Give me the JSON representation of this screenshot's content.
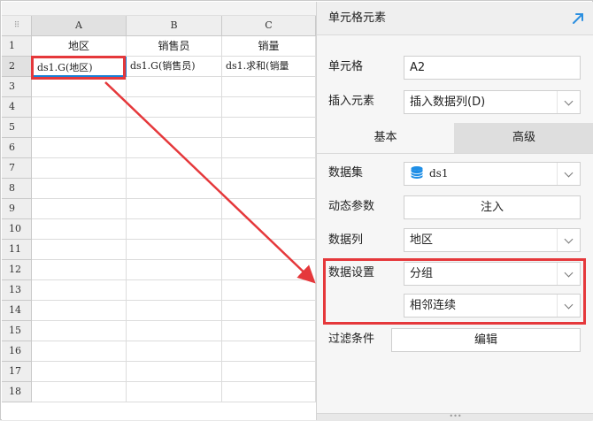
{
  "grid": {
    "corner_glyph": "⠿",
    "columns": [
      "A",
      "B",
      "C"
    ],
    "rows": [
      "1",
      "2",
      "3",
      "4",
      "5",
      "6",
      "7",
      "8",
      "9",
      "10",
      "11",
      "12",
      "13",
      "14",
      "15",
      "16",
      "17",
      "18"
    ],
    "header_row": [
      "地区",
      "销售员",
      "销量"
    ],
    "data_row": [
      "ds1.G(地区)",
      "ds1.G(销售员)",
      "ds1.求和(销量"
    ]
  },
  "panel": {
    "title": "单元格元素",
    "cell_label": "单元格",
    "cell_value": "A2",
    "insert_label": "插入元素",
    "insert_value": "插入数据列(D)",
    "tabs": {
      "basic": "基本",
      "advanced": "高级"
    },
    "dataset_label": "数据集",
    "dataset_value": "ds1",
    "dynamic_label": "动态参数",
    "dynamic_button": "注入",
    "column_label": "数据列",
    "column_value": "地区",
    "setting_label": "数据设置",
    "setting_value": "分组",
    "setting_sub_value": "相邻连续",
    "filter_label": "过滤条件",
    "filter_button": "编辑",
    "bottom_handle": "•••"
  },
  "colors": {
    "annotation": "#e5383b",
    "selection": "#1b7fd4",
    "expand_icon": "#2b8fe0"
  }
}
